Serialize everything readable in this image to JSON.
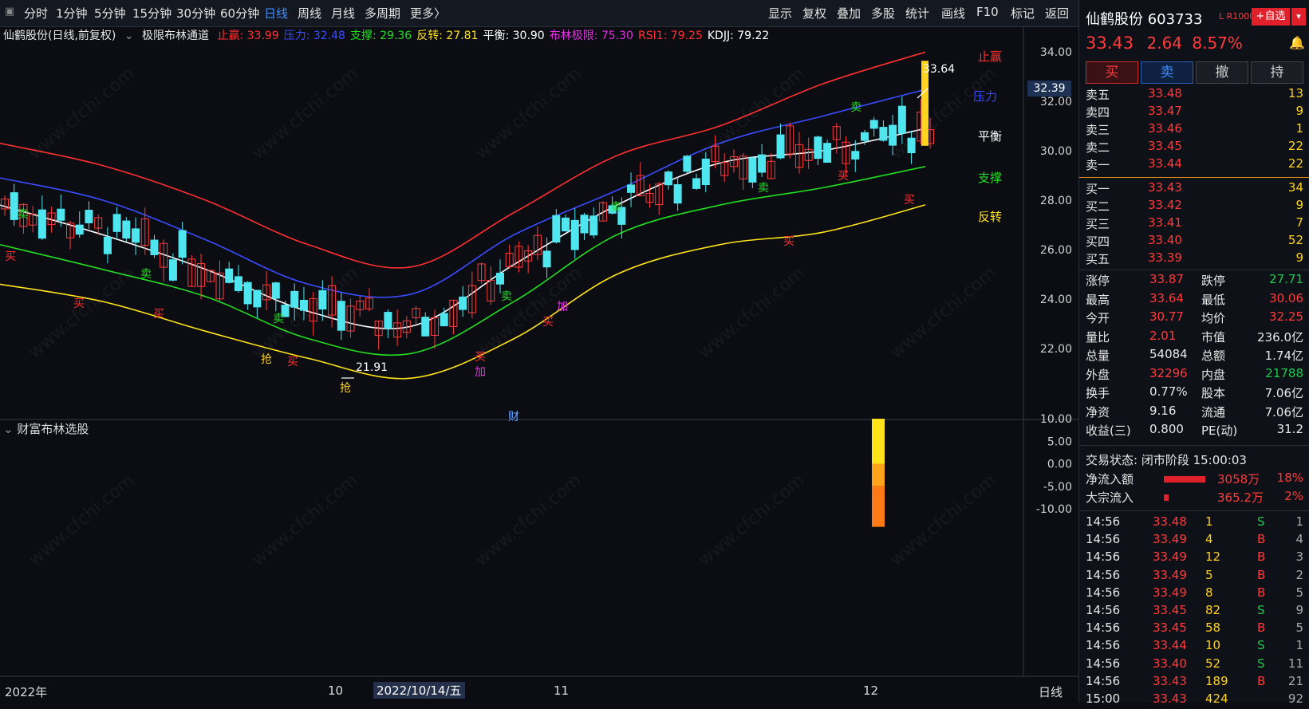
{
  "toolbar": {
    "periods": [
      "分时",
      "1分钟",
      "5分钟",
      "15分钟",
      "30分钟",
      "60分钟",
      "日线",
      "周线",
      "月线",
      "多周期",
      "更多〉"
    ],
    "active_period": "日线",
    "tools": [
      "显示",
      "复权",
      "叠加",
      "多股",
      "统计",
      "画线",
      "F10",
      "标记",
      "返回"
    ]
  },
  "main_chart": {
    "title": "仙鹤股份(日线,前复权)",
    "indicator": "极限布林通道",
    "params": [
      {
        "label": "止赢: 33.99",
        "color": "#ff3030"
      },
      {
        "label": "压力: 32.48",
        "color": "#3a4cff"
      },
      {
        "label": "支撑: 29.36",
        "color": "#22dd22"
      },
      {
        "label": "反转: 27.81",
        "color": "#ffe21a"
      },
      {
        "label": "平衡: 30.90",
        "color": "#ffffff"
      },
      {
        "label": "布林极限: 75.30",
        "color": "#e030e0"
      },
      {
        "label": "RSI1: 79.25",
        "color": "#ff3030"
      },
      {
        "label": "KDJJ: 79.22",
        "color": "#ffffff"
      }
    ],
    "y_ticks": [
      "34.00",
      "32.00",
      "30.00",
      "28.00",
      "26.00",
      "24.00",
      "22.00"
    ],
    "current_price_tag": "32.39",
    "high_label": "33.64",
    "low_label": "21.91",
    "line_labels": {
      "stop": "止赢",
      "pressure": "压力",
      "balance": "平衡",
      "support": "支撑",
      "reverse": "反转"
    },
    "signal_buy": "买",
    "signal_sell": "卖",
    "signal_grab": "抢",
    "signal_add": "加",
    "signal_finance": "财"
  },
  "sub_chart": {
    "title": "财富布林选股",
    "y_ticks": [
      "10.00",
      "5.00",
      "0.00",
      "-5.00",
      "-10.00"
    ]
  },
  "x_axis": {
    "labels": [
      "2022年",
      "10",
      "2022/10/14/五",
      "11",
      "12"
    ],
    "period_label": "日线"
  },
  "chart_data": {
    "type": "candlestick",
    "title": "仙鹤股份(日线,前复权)",
    "ylim": [
      21,
      34.5
    ],
    "series": [
      {
        "name": "止赢",
        "color": "#ff3030",
        "values": [
          30.3,
          29.4,
          28.0,
          26.2,
          25.3,
          27.5,
          29.8,
          31.0,
          32.7,
          33.99
        ]
      },
      {
        "name": "压力",
        "color": "#3a4cff",
        "values": [
          28.9,
          28.0,
          26.4,
          24.6,
          24.2,
          26.6,
          28.4,
          30.3,
          31.4,
          32.48
        ]
      },
      {
        "name": "平衡",
        "color": "#ffffff",
        "values": [
          27.8,
          26.6,
          25.2,
          23.5,
          22.9,
          25.4,
          27.8,
          29.5,
          30.0,
          30.9
        ]
      },
      {
        "name": "支撑",
        "color": "#22dd22",
        "values": [
          26.2,
          25.2,
          24.1,
          22.4,
          21.8,
          23.9,
          26.6,
          27.8,
          28.5,
          29.36
        ]
      },
      {
        "name": "反转",
        "color": "#ffe21a",
        "values": [
          24.6,
          23.9,
          22.7,
          21.6,
          20.8,
          22.4,
          25.0,
          26.2,
          26.7,
          27.81
        ]
      }
    ],
    "sub_bar": {
      "top": 10.0,
      "bottom": -14.0
    }
  },
  "quote": {
    "name": "仙鹤股份",
    "code": "603733",
    "tag": "L R1000",
    "add_watch": "+自选",
    "price": "33.43",
    "change": "2.64",
    "pct": "8.57%",
    "buttons": [
      "买",
      "卖",
      "撤",
      "持"
    ],
    "asks": [
      {
        "label": "卖五",
        "price": "33.48",
        "vol": "13"
      },
      {
        "label": "卖四",
        "price": "33.47",
        "vol": "9"
      },
      {
        "label": "卖三",
        "price": "33.46",
        "vol": "1"
      },
      {
        "label": "卖二",
        "price": "33.45",
        "vol": "22"
      },
      {
        "label": "卖一",
        "price": "33.44",
        "vol": "22"
      }
    ],
    "bids": [
      {
        "label": "买一",
        "price": "33.43",
        "vol": "34"
      },
      {
        "label": "买二",
        "price": "33.42",
        "vol": "9"
      },
      {
        "label": "买三",
        "price": "33.41",
        "vol": "7"
      },
      {
        "label": "买四",
        "price": "33.40",
        "vol": "52"
      },
      {
        "label": "买五",
        "price": "33.39",
        "vol": "9"
      }
    ],
    "stats": [
      {
        "l1": "涨停",
        "v1": "33.87",
        "c1": "#ff3b3b",
        "l2": "跌停",
        "v2": "27.71",
        "c2": "#1ecb4f"
      },
      {
        "l1": "最高",
        "v1": "33.64",
        "c1": "#ff3b3b",
        "l2": "最低",
        "v2": "30.06",
        "c2": "#ff3b3b"
      },
      {
        "l1": "今开",
        "v1": "30.77",
        "c1": "#ff3b3b",
        "l2": "均价",
        "v2": "32.25",
        "c2": "#ff3b3b"
      },
      {
        "l1": "量比",
        "v1": "2.01",
        "c1": "#ff3b3b",
        "l2": "市值",
        "v2": "236.0亿",
        "c2": "#e8e8e8"
      },
      {
        "l1": "总量",
        "v1": "54084",
        "c1": "#e8e8e8",
        "l2": "总额",
        "v2": "1.74亿",
        "c2": "#e8e8e8"
      },
      {
        "l1": "外盘",
        "v1": "32296",
        "c1": "#ff3b3b",
        "l2": "内盘",
        "v2": "21788",
        "c2": "#1ecb4f"
      },
      {
        "l1": "换手",
        "v1": "0.77%",
        "c1": "#e8e8e8",
        "l2": "股本",
        "v2": "7.06亿",
        "c2": "#e8e8e8"
      },
      {
        "l1": "净资",
        "v1": "9.16",
        "c1": "#e8e8e8",
        "l2": "流通",
        "v2": "7.06亿",
        "c2": "#e8e8e8"
      },
      {
        "l1": "收益(三)",
        "v1": "0.800",
        "c1": "#e8e8e8",
        "l2": "PE(动)",
        "v2": "31.2",
        "c2": "#e8e8e8"
      }
    ],
    "trade_status": "交易状态: 闭市阶段 15:00:03",
    "flows": [
      {
        "label": "净流入额",
        "amount": "3058万",
        "pct": "18%",
        "bar": 0.18
      },
      {
        "label": "大宗流入",
        "amount": "365.2万",
        "pct": "2%",
        "bar": 0.02
      }
    ],
    "ticks": [
      {
        "time": "14:56",
        "price": "33.48",
        "vol": "1",
        "side": "S",
        "n": "1"
      },
      {
        "time": "14:56",
        "price": "33.49",
        "vol": "4",
        "side": "B",
        "n": "4"
      },
      {
        "time": "14:56",
        "price": "33.49",
        "vol": "12",
        "side": "B",
        "n": "3"
      },
      {
        "time": "14:56",
        "price": "33.49",
        "vol": "5",
        "side": "B",
        "n": "2"
      },
      {
        "time": "14:56",
        "price": "33.49",
        "vol": "8",
        "side": "B",
        "n": "5"
      },
      {
        "time": "14:56",
        "price": "33.45",
        "vol": "82",
        "side": "S",
        "n": "9"
      },
      {
        "time": "14:56",
        "price": "33.45",
        "vol": "58",
        "side": "B",
        "n": "5"
      },
      {
        "time": "14:56",
        "price": "33.44",
        "vol": "10",
        "side": "S",
        "n": "1"
      },
      {
        "time": "14:56",
        "price": "33.40",
        "vol": "52",
        "side": "S",
        "n": "11"
      },
      {
        "time": "14:56",
        "price": "33.43",
        "vol": "189",
        "side": "B",
        "n": "21"
      },
      {
        "time": "15:00",
        "price": "33.43",
        "vol": "424",
        "side": "",
        "n": "92"
      }
    ]
  }
}
